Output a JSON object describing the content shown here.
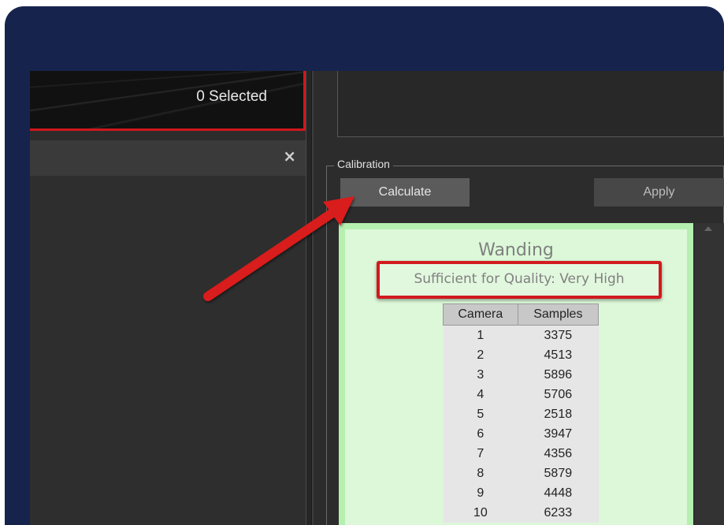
{
  "viewport": {
    "selected_label": "0 Selected"
  },
  "panel": {
    "close_glyph": "×"
  },
  "calibration": {
    "group_label": "Calibration",
    "calculate_label": "Calculate",
    "apply_label": "Apply",
    "report": {
      "title": "Wanding",
      "quality_text": "Sufficient for Quality: Very High",
      "columns": [
        "Camera",
        "Samples"
      ],
      "rows": [
        [
          "1",
          "3375"
        ],
        [
          "2",
          "4513"
        ],
        [
          "3",
          "5896"
        ],
        [
          "4",
          "5706"
        ],
        [
          "5",
          "2518"
        ],
        [
          "6",
          "3947"
        ],
        [
          "7",
          "4356"
        ],
        [
          "8",
          "5879"
        ],
        [
          "9",
          "4448"
        ],
        [
          "10",
          "6233"
        ]
      ]
    }
  },
  "colors": {
    "frame": "#16244d",
    "highlight_red": "#d11a1f",
    "report_green": "#b6f0b0"
  },
  "icons": {
    "close": "close-icon",
    "annotation_arrow": "red-arrow-annotation"
  }
}
